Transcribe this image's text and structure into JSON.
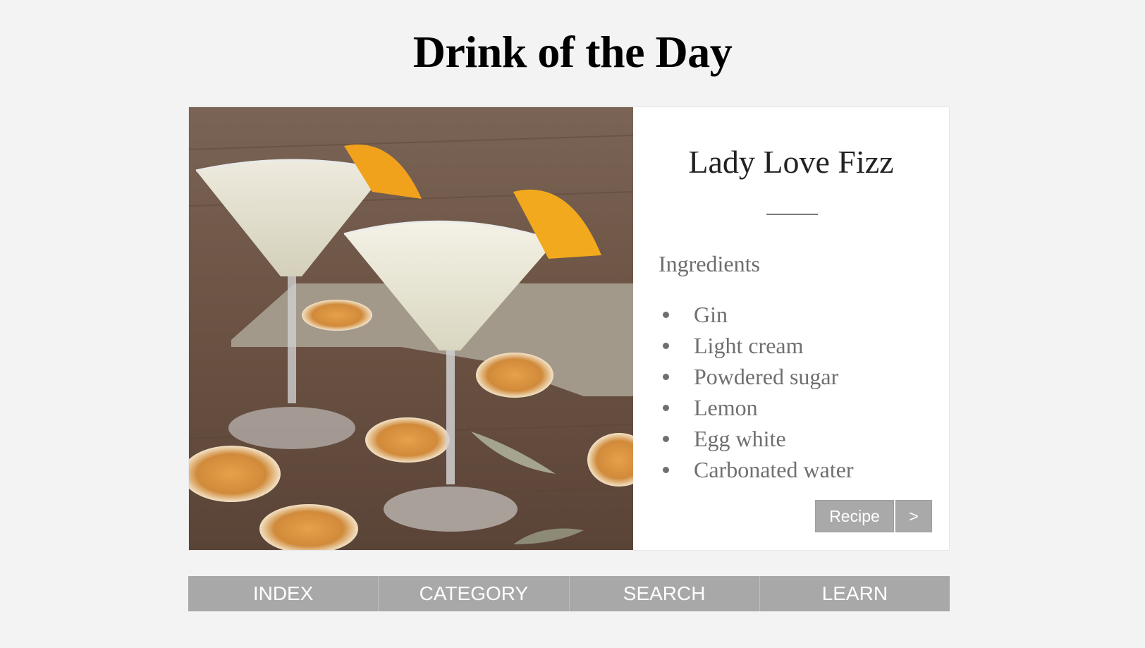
{
  "page": {
    "title": "Drink of the Day"
  },
  "drink": {
    "name": "Lady Love Fizz",
    "image_icon": "cocktail-photo",
    "ingredients_heading": "Ingredients",
    "ingredients": [
      "Gin",
      "Light cream",
      "Powdered sugar",
      "Lemon",
      "Egg white",
      "Carbonated water"
    ],
    "recipe_button": "Recipe",
    "next_button": ">"
  },
  "nav": {
    "items": [
      "INDEX",
      "CATEGORY",
      "SEARCH",
      "LEARN"
    ]
  },
  "colors": {
    "background": "#f3f3f3",
    "button": "#a9a9a9",
    "nav": "#a8a8a8",
    "text_muted": "#6f6f6f"
  }
}
